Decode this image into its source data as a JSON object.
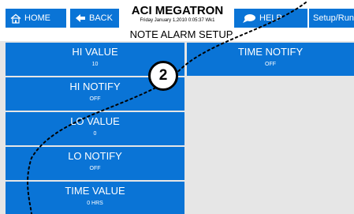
{
  "header": {
    "home_label": "HOME",
    "back_label": "BACK",
    "title": "ACI MEGATRON",
    "datetime": "Friday January 1,2010 0:05:37 Wk1",
    "help_label": "HELP",
    "setup_label": "Setup/Run",
    "page_title": "NOTE ALARM SETUP"
  },
  "tiles": {
    "hi_value": {
      "label": "HI VALUE",
      "value": "10"
    },
    "hi_notify": {
      "label": "HI NOTIFY",
      "value": "OFF"
    },
    "lo_value": {
      "label": "LO VALUE",
      "value": "0"
    },
    "lo_notify": {
      "label": "LO NOTIFY",
      "value": "OFF"
    },
    "time_value": {
      "label": "TIME VALUE",
      "value": "0 HRS"
    },
    "time_notify": {
      "label": "TIME NOTIFY",
      "value": "OFF"
    }
  },
  "callout": {
    "number": "2"
  },
  "colors": {
    "button_blue": "#0a74d6",
    "panel_gray": "#e6e6e6"
  },
  "icons": [
    "home-icon",
    "back-arrow-icon",
    "speech-bubble-icon"
  ]
}
